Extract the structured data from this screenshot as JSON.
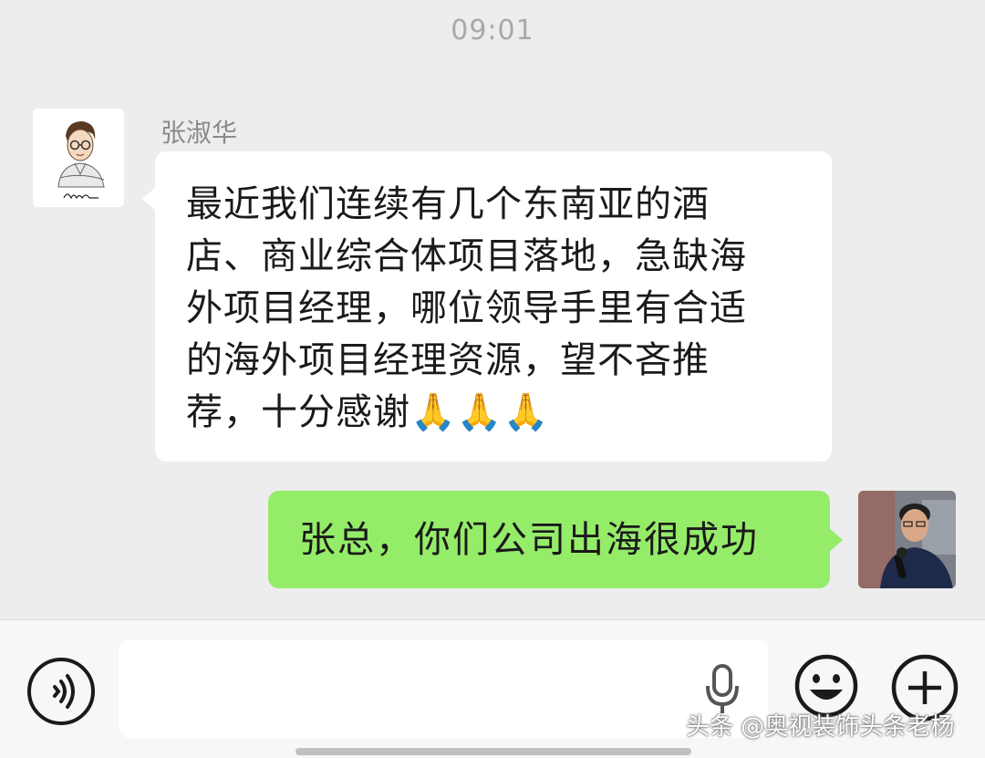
{
  "chat": {
    "timestamp": "09:01",
    "incoming": {
      "sender_name": "张淑华",
      "avatar_icon": "sketch-man-avatar-icon",
      "lines": [
        "最近我们连续有几个东南亚的酒",
        "店、商业综合体项目落地，急缺海",
        "外项目经理，哪位领导手里有合适",
        "的海外项目经理资源，望不吝推",
        "荐，十分感谢"
      ],
      "emojis": [
        "🙏",
        "🙏",
        "🙏"
      ]
    },
    "outgoing": {
      "text": "张总，你们公司出海很成功",
      "avatar_icon": "speaker-photo-avatar-icon",
      "bubble_color": "#95ec69"
    }
  },
  "input_bar": {
    "voice_icon": "voice-toggle-icon",
    "mic_icon": "microphone-icon",
    "emoji_icon": "smiley-face-icon",
    "plus_icon": "plus-circle-icon"
  },
  "watermark": "头条 @奥视装饰头条老杨"
}
